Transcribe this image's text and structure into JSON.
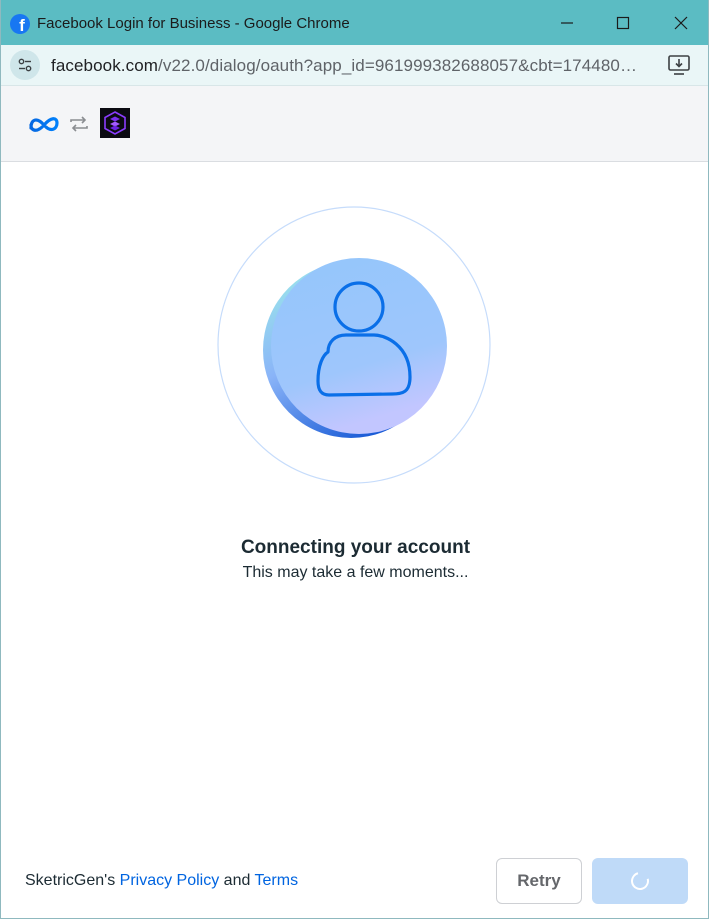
{
  "window": {
    "title": "Facebook Login for Business - Google Chrome"
  },
  "addressbar": {
    "url_host": "facebook.com",
    "url_path": "/v22.0/dialog/oauth?app_id=961999382688057&cbt=174480…"
  },
  "header": {
    "icons": [
      "meta-logo",
      "swap-arrows-icon",
      "sketricgen-app-logo"
    ]
  },
  "main": {
    "heading": "Connecting your account",
    "subheading": "This may take a few moments..."
  },
  "footer": {
    "prefix": "SketricGen's ",
    "privacy_label": "Privacy Policy",
    "and_text": " and ",
    "terms_label": "Terms",
    "retry_label": "Retry",
    "continue_state": "loading"
  },
  "colors": {
    "titlebar": "#5bbcc3",
    "addressbar": "#eaf6f7",
    "link": "#0064e0",
    "primary_disabled": "#bfdaf8"
  }
}
